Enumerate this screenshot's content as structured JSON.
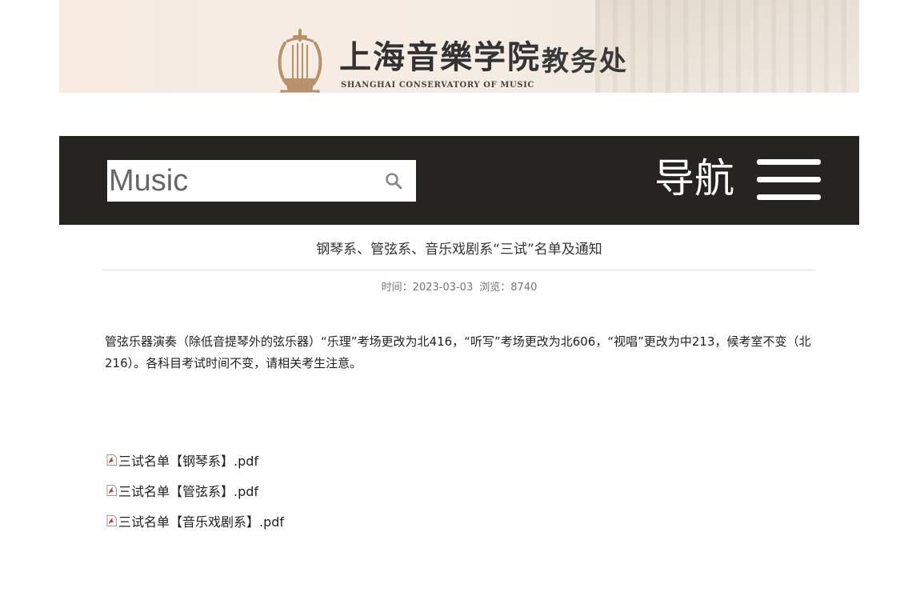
{
  "header": {
    "logo_cn": "上海音樂学院",
    "logo_en": "SHANGHAI CONSERVATORY OF MUSIC",
    "office_title": "教务处"
  },
  "navbar": {
    "search_placeholder": "Music",
    "nav_label": "导航"
  },
  "article": {
    "title": "钢琴系、管弦系、音乐戏剧系“三试”名单及通知",
    "time_label": "时间：",
    "date": "2023-03-03",
    "views_label": "浏览：",
    "views": "8740",
    "paragraph": "管弦乐器演奏（除低音提琴外的弦乐器）“乐理”考场更改为北416，“听写”考场更改为北606，“视唱”更改为中213，候考室不变（北216）。各科目考试时间不变，请相关考生注意。",
    "attachments": [
      {
        "label": "三试名单【钢琴系】.pdf"
      },
      {
        "label": "三试名单【管弦系】.pdf"
      },
      {
        "label": "三试名单【音乐戏剧系】.pdf"
      }
    ]
  },
  "colors": {
    "banner_bg": "#f7ebe2",
    "navbar_bg": "#262421",
    "logo_gold": "#b8926a",
    "pdf_red": "#c0392b"
  },
  "icons": {
    "logo": "lyre-logo-icon",
    "search": "search-icon",
    "menu": "hamburger-menu-icon",
    "attachment": "pdf-file-icon"
  }
}
